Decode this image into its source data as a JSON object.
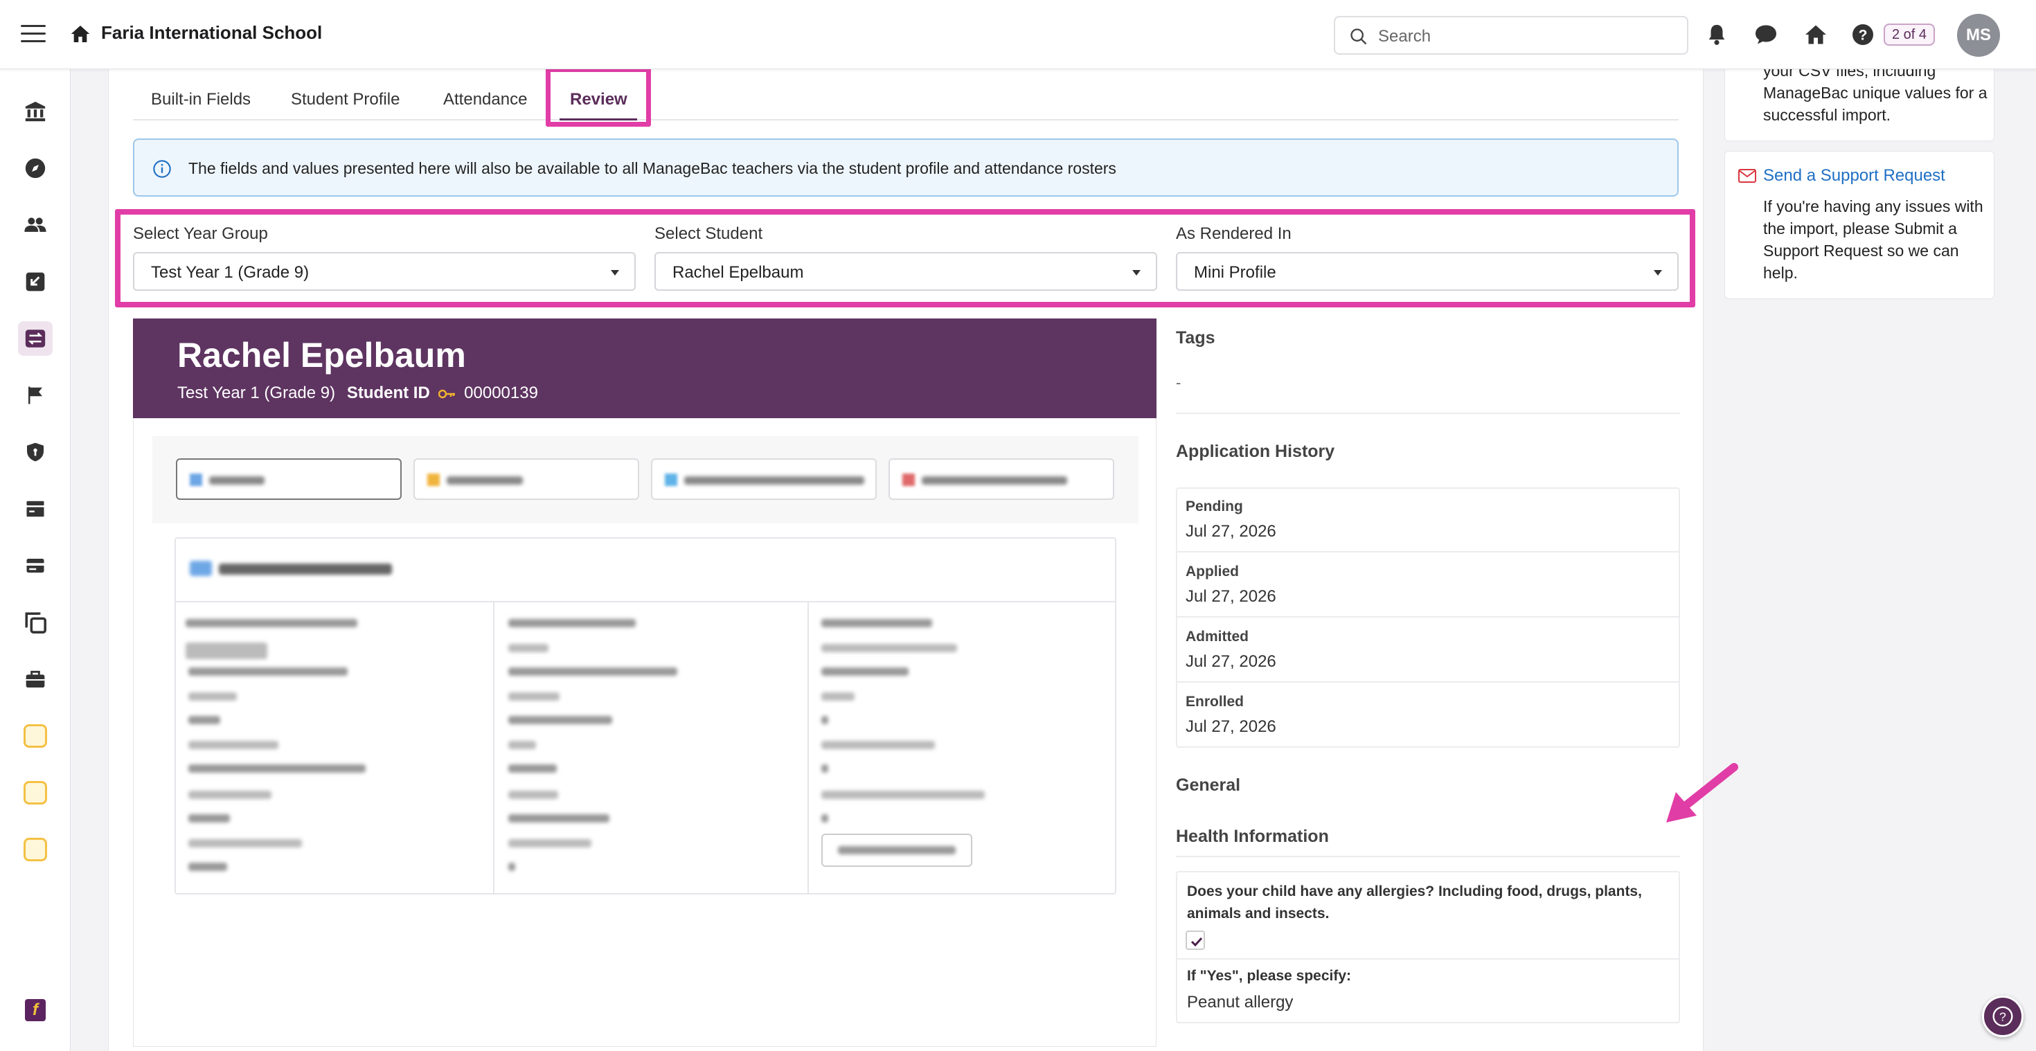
{
  "header": {
    "school_name": "Faria International School",
    "search_placeholder": "Search",
    "pager": "2 of 4",
    "avatar_initials": "MS",
    "icons": [
      "menu-icon",
      "home-icon",
      "search-icon",
      "bell-icon",
      "chat-icon",
      "house-icon",
      "help-icon"
    ]
  },
  "sidebar": {
    "icons": [
      "bank-icon",
      "compass-icon",
      "users-icon",
      "import-icon",
      "transfer-icon",
      "flag-icon",
      "shield-icon",
      "card-icon",
      "id-card-icon",
      "copy-icon",
      "briefcase-icon",
      "program-a-icon",
      "program-b-icon",
      "program-c-icon"
    ],
    "active_index": 4
  },
  "tabs": [
    {
      "label": "Built-in Fields"
    },
    {
      "label": "Student Profile"
    },
    {
      "label": "Attendance"
    },
    {
      "label": "Review"
    }
  ],
  "active_tab": "Review",
  "info_banner": "The fields and values presented here will also be available to all ManageBac teachers via the student profile and attendance rosters",
  "filters": {
    "year_group_label": "Select Year Group",
    "year_group_value": "Test Year 1 (Grade 9)",
    "student_label": "Select Student",
    "student_value": "Rachel Epelbaum",
    "rendered_label": "As Rendered In",
    "rendered_value": "Mini Profile"
  },
  "profile": {
    "name": "Rachel Epelbaum",
    "year": "Test Year 1 (Grade 9)",
    "student_id_label": "Student ID",
    "student_id": "00000139"
  },
  "right": {
    "tags_title": "Tags",
    "tags_value": "-",
    "history_title": "Application History",
    "history": [
      {
        "label": "Pending",
        "date": "Jul 27, 2026"
      },
      {
        "label": "Applied",
        "date": "Jul 27, 2026"
      },
      {
        "label": "Admitted",
        "date": "Jul 27, 2026"
      },
      {
        "label": "Enrolled",
        "date": "Jul 27, 2026"
      }
    ],
    "general_title": "General",
    "health_title": "Health Information",
    "question1": "Does your child have any allergies? Including food, drugs, plants, animals and insects.",
    "question1_checked": true,
    "question2": "If \"Yes\", please specify:",
    "answer2": "Peanut allergy"
  },
  "help": {
    "text1": "your CSV files, including ManageBac unique values for a successful import.",
    "support_link": "Send a Support Request",
    "text2": "If you're having any issues with the import, please Submit a Support Request so we can help."
  },
  "colors": {
    "brand_purple": "#5e3461",
    "highlight_pink": "#e13da6",
    "link_blue": "#1f6fc4"
  }
}
